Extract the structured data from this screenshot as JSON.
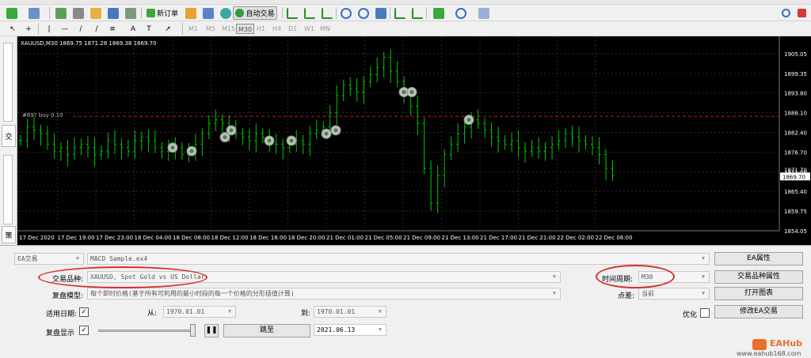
{
  "toolbar": {
    "new_order": "新订单",
    "auto_trade": "自动交易",
    "timeframes": [
      "M1",
      "M5",
      "M15",
      "M30",
      "H1",
      "H4",
      "D1",
      "W1",
      "MN"
    ],
    "active_timeframe": "M30"
  },
  "side_tabs": [
    "交",
    "策"
  ],
  "chart": {
    "header": "XAUUSD,M30  1869.75 1871.28 1869.38 1869.70",
    "order_label": "#69? buy 0.10",
    "current_price": "1869.70",
    "price_line": "1871.70",
    "y_ticks": [
      "1905.05",
      "1899.35",
      "1893.80",
      "1888.10",
      "1882.40",
      "1876.70",
      "1871.00",
      "1865.40",
      "1859.75",
      "1854.05"
    ],
    "x_ticks": [
      "17 Dec 2020",
      "17 Dec 19:00",
      "17 Dec 23:00",
      "18 Dec 04:00",
      "18 Dec 08:00",
      "18 Dec 12:00",
      "18 Dec 16:00",
      "18 Dec 20:00",
      "21 Dec 01:00",
      "21 Dec 05:00",
      "21 Dec 09:00",
      "21 Dec 13:00",
      "21 Dec 17:00",
      "21 Dec 21:00",
      "22 Dec 02:00",
      "22 Dec 06:00"
    ],
    "colors": {
      "bg": "#000000",
      "candle": "#00c800",
      "grid": "#2a2a2a",
      "order_line": "#c8141e",
      "text": "#ffffff"
    }
  },
  "tester": {
    "mode": "EA交易",
    "expert": "MACD Sample.ex4",
    "symbol_label": "交易品种:",
    "symbol": "XAUUSD, Spot Gold vs US Dollar",
    "period_label": "时间周期:",
    "period": "M30",
    "model_label": "复盘模型:",
    "model": "每个即时价格(基于所有可利用的最小时段的每一个价格的分形插值计算)",
    "spread_label": "点差:",
    "spread": "当前",
    "use_date_label": "适用日期:",
    "from_label": "从:",
    "from_date": "1970.01.01",
    "to_label": "到:",
    "to_date": "1970.01.01",
    "visual_label": "复盘显示",
    "skip_to": "跳至",
    "skip_date": "2021.06.13",
    "optimize_label": "优化",
    "btn_expert_props": "EA属性",
    "btn_symbol_props": "交易品种属性",
    "btn_open_chart": "打开图表",
    "btn_modify_expert": "修改EA交易"
  },
  "watermark": {
    "brand": "EAHub",
    "site": "www.eahub168.com"
  }
}
